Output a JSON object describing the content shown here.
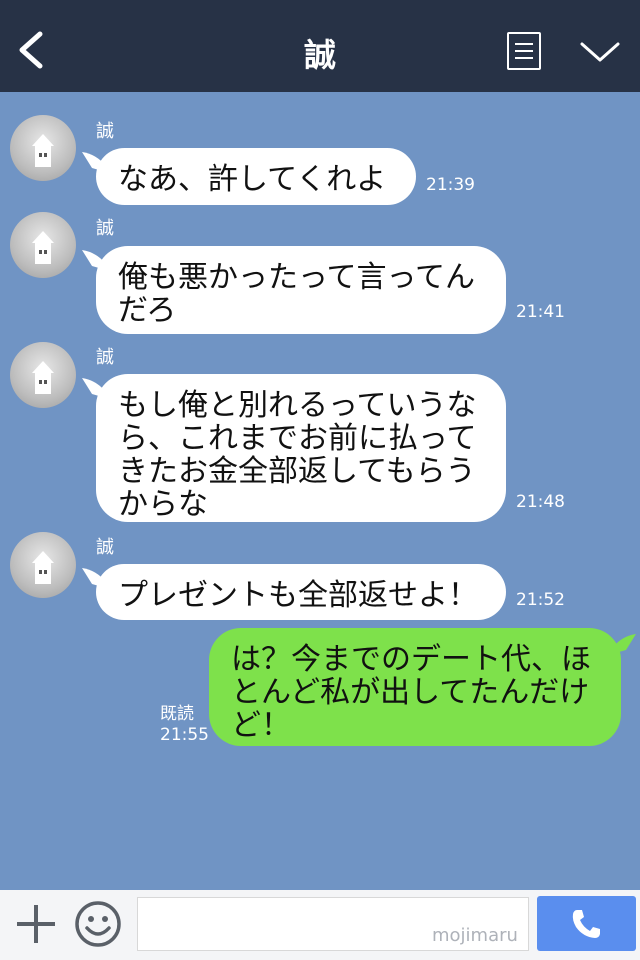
{
  "header": {
    "title": "誠"
  },
  "messages": [
    {
      "sender": "誠",
      "text": "なあ、許してくれよ",
      "time": "21:39"
    },
    {
      "sender": "誠",
      "line1": "俺も悪かったって言ってん",
      "line2": "だろ",
      "time": "21:41"
    },
    {
      "sender": "誠",
      "line1": "もし俺と別れるっていうな",
      "line2": "ら、これまでお前に払って",
      "line3": "きたお金全部返してもらう",
      "line4": "からな",
      "time": "21:48"
    },
    {
      "sender": "誠",
      "text": "プレゼントも全部返せよ！",
      "time": "21:52"
    }
  ],
  "reply": {
    "line1": "は？今までのデート代、ほ",
    "line2": "とんど私が出してたんだけ",
    "line3": "ど！",
    "read_label": "既読",
    "time": "21:55"
  },
  "bottom": {
    "watermark": "mojimaru"
  },
  "colors": {
    "header": "#273246",
    "chat_bg": "#7094c4",
    "my_bubble": "#7ee14b",
    "call_button": "#5a8eee"
  },
  "icons": [
    "back-arrow-icon",
    "menu-list-icon",
    "chevron-down-icon",
    "plus-icon",
    "smile-icon",
    "phone-icon"
  ]
}
